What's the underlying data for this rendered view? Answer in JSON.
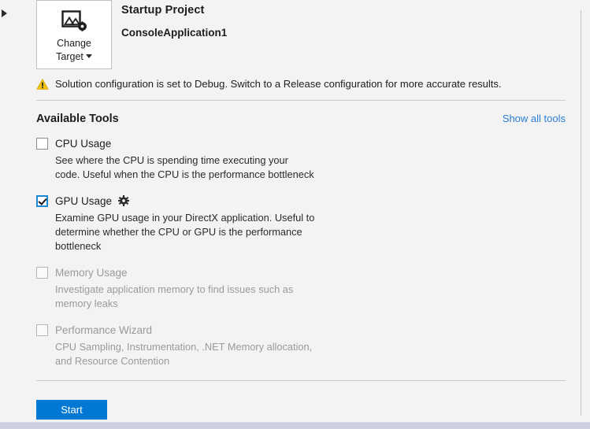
{
  "header": {
    "change_target": {
      "icon": "image-settings-icon",
      "line1": "Change",
      "line2": "Target",
      "caret": "chevron-down-icon"
    },
    "startup_label": "Startup Project",
    "startup_project": "ConsoleApplication1"
  },
  "warning": {
    "icon": "warning-triangle-icon",
    "text": "Solution configuration is set to Debug. Switch to a Release configuration for more accurate results."
  },
  "tools_section": {
    "title": "Available Tools",
    "show_all_label": "Show all tools"
  },
  "tools": [
    {
      "name": "CPU Usage",
      "checked": false,
      "disabled": false,
      "has_settings": false,
      "description": "See where the CPU is spending time executing your code. Useful when the CPU is the performance bottleneck"
    },
    {
      "name": "GPU Usage",
      "checked": true,
      "disabled": false,
      "has_settings": true,
      "settings_icon": "gear-icon",
      "description": "Examine GPU usage in your DirectX application. Useful to determine whether the CPU or GPU is the performance bottleneck"
    },
    {
      "name": "Memory Usage",
      "checked": false,
      "disabled": true,
      "has_settings": false,
      "description": "Investigate application memory to find issues such as memory leaks"
    },
    {
      "name": "Performance Wizard",
      "checked": false,
      "disabled": true,
      "has_settings": false,
      "description": "CPU Sampling, Instrumentation, .NET Memory allocation, and Resource Contention"
    }
  ],
  "footer": {
    "start_label": "Start"
  },
  "colors": {
    "accent": "#0078d4",
    "link": "#2a7fd4",
    "warning": "#f2c314",
    "checkbox_checked_border": "#1a8ad4",
    "disabled_text": "#9a9a9a",
    "page_background": "#f3f3f3",
    "bottom_strip": "#ccd0e0"
  }
}
